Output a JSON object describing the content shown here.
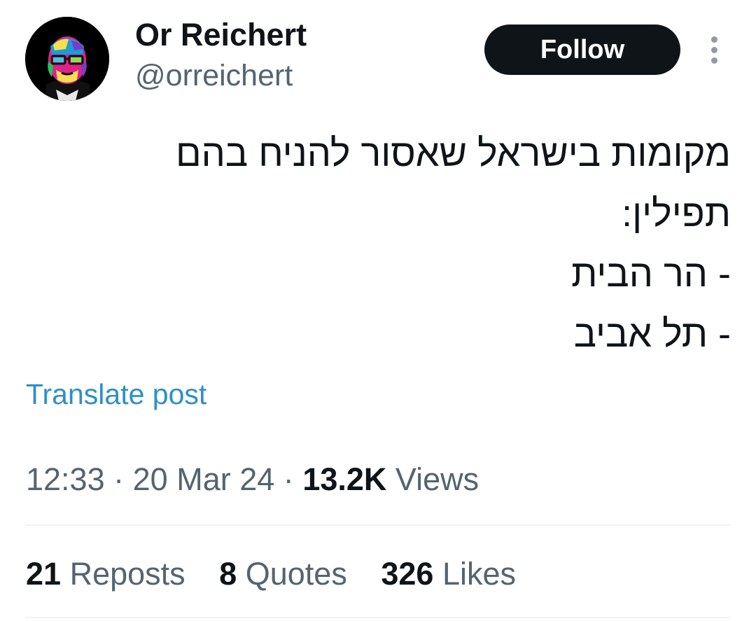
{
  "author": {
    "name": "Or Reichert",
    "handle": "@orreichert"
  },
  "actions": {
    "follow_label": "Follow",
    "more_icon": "more-vertical-icon"
  },
  "tweet": {
    "lines": [
      "מקומות בישראל שאסור להניח בהם",
      "תפילין:",
      "- הר הבית",
      "- תל אביב"
    ],
    "translate_label": "Translate post"
  },
  "meta": {
    "time": "12:33",
    "date": "20 Mar 24",
    "separator": "·",
    "views_count": "13.2K",
    "views_label": "Views"
  },
  "stats": {
    "reposts_count": "21",
    "reposts_label": "Reposts",
    "quotes_count": "8",
    "quotes_label": "Quotes",
    "likes_count": "326",
    "likes_label": "Likes"
  },
  "colors": {
    "follow_bg": "#0f1419",
    "link": "#2f8fc8",
    "muted": "#536471"
  }
}
